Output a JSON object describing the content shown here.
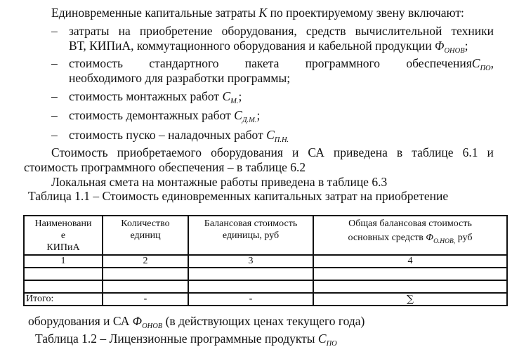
{
  "paragraph1": {
    "intro": "Единовременные капитальные  затраты",
    "intro_var": "K",
    "intro_rest": "по проектируемому звену включают:"
  },
  "list": [
    {
      "dash": "–",
      "line1_words": [
        "затраты",
        "на",
        "приобретение",
        "оборудования,",
        "средств",
        "вычислительной",
        "техники"
      ],
      "line2": "ВТ, КИПиА, коммутационного оборудования и кабельной продукции",
      "var": "Φ",
      "sub": "ОНОВ",
      "end": ";"
    },
    {
      "dash": "–",
      "line1_words": [
        "стоимость",
        "стандартного",
        "пакета",
        "программного",
        "обеспечения"
      ],
      "var": "C",
      "sub": "ПО",
      "end": ",",
      "line2": "необходимого для разработки программы;"
    },
    {
      "dash": "–",
      "text": "стоимость монтажных работ",
      "var": "C",
      "sub": "М.",
      "end": ";"
    },
    {
      "dash": "–",
      "text": "стоимость демонтажных работ",
      "var": "C",
      "sub": "Д.М.",
      "end": ";"
    },
    {
      "dash": "–",
      "text": "стоимость пуско – наладочных работ",
      "var": "C",
      "sub": "П.Н.",
      "end": ""
    }
  ],
  "paragraph2": {
    "line1_words": [
      "Стоимость",
      "приобретаемого",
      "оборудования",
      "и",
      "СА",
      "приведена",
      "в",
      "таблице",
      "6.1",
      "и"
    ],
    "line2": "стоимость программного обеспечения – в таблице 6.2"
  },
  "paragraph3": "Локальная смета на монтажные работы приведена в таблице 6.3",
  "table1": {
    "caption": "Таблица 1.1 – Стоимость единовременных капитальных затрат на  приобретение",
    "headers": [
      {
        "l1": "Наименовани",
        "l2": "е",
        "l3": "КИПиА"
      },
      {
        "l1": "Количество",
        "l2": "единиц"
      },
      {
        "l1": "Балансовая стоимость",
        "l2": "единицы, руб"
      },
      {
        "l1": "Общая балансовая стоимость",
        "l2": "основных средств",
        "var": "Φ",
        "sub": "О.НОВ,",
        "unit": "руб"
      }
    ],
    "numbers_row": [
      "1",
      "2",
      "3",
      "4"
    ],
    "empty_rows": 2,
    "total_row": [
      "Итого:",
      "-",
      "-",
      "∑"
    ],
    "after_text": "оборудования и СА",
    "after_var": "Φ",
    "after_sub": "ОНОВ",
    "after_rest": "(в действующих ценах текущего года)"
  },
  "table2": {
    "caption": "Таблица 1.2 – Лицензионные программные продукты",
    "var": "C",
    "sub": "ПО"
  }
}
